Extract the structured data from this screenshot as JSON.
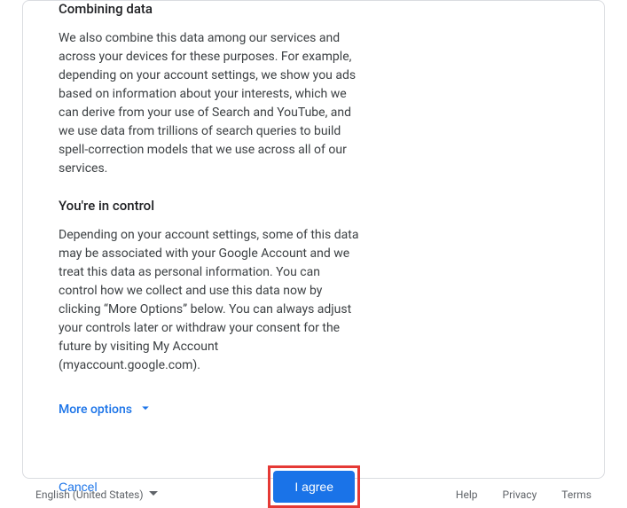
{
  "sections": {
    "combining": {
      "heading": "Combining data",
      "text": "We also combine this data among our services and across your devices for these purposes. For example, depending on your account settings, we show you ads based on information about your interests, which we can derive from your use of Search and YouTube, and we use data from trillions of search queries to build spell-correction models that we use across all of our services."
    },
    "control": {
      "heading": "You're in control",
      "text": "Depending on your account settings, some of this data may be associated with your Google Account and we treat this data as personal information. You can control how we collect and use this data now by clicking “More Options” below. You can always adjust your controls later or withdraw your consent for the future by visiting My Account (myaccount.google.com)."
    }
  },
  "more_options_label": "More options",
  "buttons": {
    "cancel": "Cancel",
    "agree": "I agree"
  },
  "footer": {
    "language": "English (United States)",
    "links": {
      "help": "Help",
      "privacy": "Privacy",
      "terms": "Terms"
    }
  }
}
